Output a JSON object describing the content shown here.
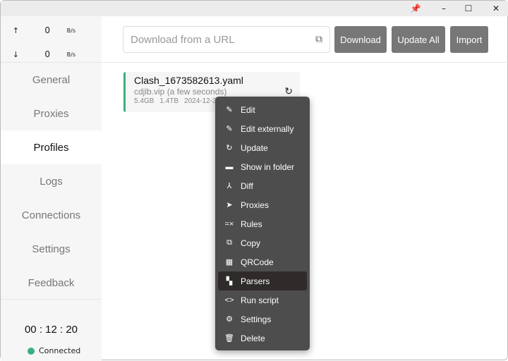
{
  "window": {
    "controls": [
      {
        "name": "pin",
        "glyph": "📌"
      },
      {
        "name": "minimize",
        "glyph": "–"
      },
      {
        "name": "maximize",
        "glyph": "☐"
      },
      {
        "name": "close",
        "glyph": "✕"
      }
    ]
  },
  "traffic": {
    "up_arrow": "↑",
    "up_value": "0",
    "up_unit": "B/s",
    "down_arrow": "↓",
    "down_value": "0",
    "down_unit": "B/s"
  },
  "nav": {
    "items": [
      "General",
      "Proxies",
      "Profiles",
      "Logs",
      "Connections",
      "Settings",
      "Feedback"
    ],
    "active": "Profiles"
  },
  "footer": {
    "timer": "00 : 12 : 20",
    "status": "Connected",
    "status_color": "#3bb07f"
  },
  "header": {
    "url_placeholder": "Download from a URL",
    "paste_icon": "⧉",
    "download": "Download",
    "update_all": "Update All",
    "import": "Import"
  },
  "profile": {
    "name": "Clash_1673582613.yaml",
    "subtitle": "cdjlb.vip (a few seconds)",
    "used": "5.4GB",
    "total": "1.4TB",
    "expire": "2024-12-3",
    "refresh_icon": "↻"
  },
  "menu": {
    "items": [
      {
        "label": "Edit",
        "icon": "✎"
      },
      {
        "label": "Edit externally",
        "icon": "✎"
      },
      {
        "label": "Update",
        "icon": "↻"
      },
      {
        "label": "Show in folder",
        "icon": "▬"
      },
      {
        "label": "Diff",
        "icon": "⅄"
      },
      {
        "label": "Proxies",
        "icon": "➤"
      },
      {
        "label": "Rules",
        "icon": "=×"
      },
      {
        "label": "Copy",
        "icon": "⧉"
      },
      {
        "label": "QRCode",
        "icon": "▦"
      },
      {
        "label": "Parsers",
        "icon": "▚"
      },
      {
        "label": "Run script",
        "icon": "<>"
      },
      {
        "label": "Settings",
        "icon": "⚙"
      },
      {
        "label": "Delete",
        "icon": "🗑"
      }
    ],
    "highlighted": "Parsers"
  }
}
